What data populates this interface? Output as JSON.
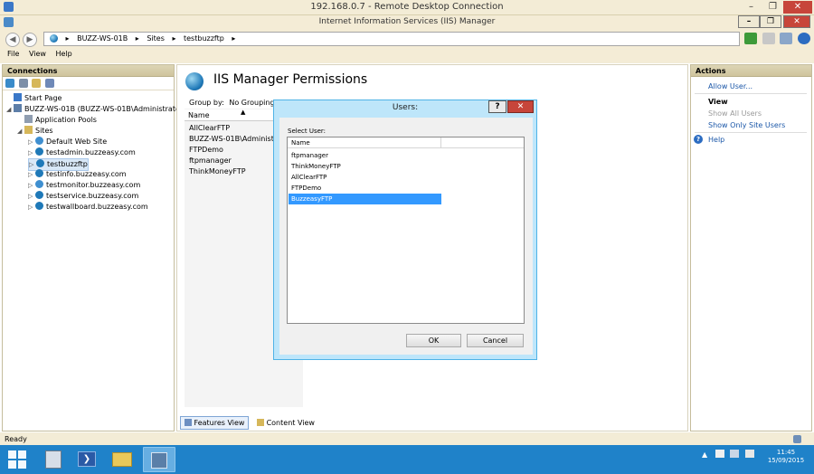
{
  "rdp": {
    "title": "192.168.0.7 - Remote Desktop Connection",
    "min": "–",
    "max": "❐",
    "close": "✕"
  },
  "window": {
    "title": "Internet Information Services (IIS) Manager",
    "min": "–",
    "max": "❐",
    "close": "✕"
  },
  "address": {
    "back": "◀",
    "forward": "▶",
    "crumbs": [
      "BUZZ-WS-01B",
      "Sites",
      "testbuzzftp"
    ],
    "sep": "▸"
  },
  "menu": [
    "File",
    "View",
    "Help"
  ],
  "connections": {
    "header": "Connections",
    "tree": [
      {
        "label": "Start Page",
        "level": 0,
        "expander": "",
        "icon": "start-page-icon"
      },
      {
        "label": "BUZZ-WS-01B (BUZZ-WS-01B\\Administrator)",
        "level": 0,
        "expander": "◢",
        "icon": "server-icon"
      },
      {
        "label": "Application Pools",
        "level": 1,
        "expander": "",
        "icon": "app-pools-icon"
      },
      {
        "label": "Sites",
        "level": 1,
        "expander": "◢",
        "icon": "sites-folder-icon"
      },
      {
        "label": "Default Web Site",
        "level": 2,
        "expander": "▷",
        "icon": "site-icon"
      },
      {
        "label": "testadmin.buzzeasy.com",
        "level": 2,
        "expander": "▷",
        "icon": "globe-icon"
      },
      {
        "label": "testbuzzftp",
        "level": 2,
        "expander": "▷",
        "icon": "globe-icon",
        "selected": true
      },
      {
        "label": "testinfo.buzzeasy.com",
        "level": 2,
        "expander": "▷",
        "icon": "globe-icon"
      },
      {
        "label": "testmonitor.buzzeasy.com",
        "level": 2,
        "expander": "▷",
        "icon": "site-icon"
      },
      {
        "label": "testservice.buzzeasy.com",
        "level": 2,
        "expander": "▷",
        "icon": "globe-icon"
      },
      {
        "label": "testwallboard.buzzeasy.com",
        "level": 2,
        "expander": "▷",
        "icon": "globe-icon"
      }
    ]
  },
  "feature": {
    "title": "IIS Manager Permissions",
    "group_by_label": "Group by:",
    "group_by_value": "No Grouping",
    "column_name": "Name",
    "sort_arrow": "▲",
    "rows": [
      "AllClearFTP",
      "BUZZ-WS-01B\\Administrat",
      "FTPDemo",
      "ftpmanager",
      "ThinkMoneyFTP"
    ]
  },
  "views": {
    "features": "Features View",
    "content": "Content View"
  },
  "actions": {
    "header": "Actions",
    "allow_user": "Allow User...",
    "view_heading": "View",
    "show_all": "Show All Users",
    "show_site": "Show Only Site Users",
    "help": "Help",
    "help_icon": "?"
  },
  "status": "Ready",
  "dialog": {
    "title": "Users:",
    "help": "?",
    "close": "✕",
    "select_label": "Select User:",
    "column": "Name",
    "users": [
      "ftpmanager",
      "ThinkMoneyFTP",
      "AllClearFTP",
      "FTPDemo",
      "BuzzeasyFTP"
    ],
    "selected_index": 4,
    "ok": "OK",
    "cancel": "Cancel"
  },
  "taskbar": {
    "apps": [
      "start-button",
      "server-manager",
      "powershell",
      "file-explorer",
      "iis-manager"
    ],
    "tray_arrow": "▲",
    "time": "11:45",
    "date": "15/09/2015"
  }
}
